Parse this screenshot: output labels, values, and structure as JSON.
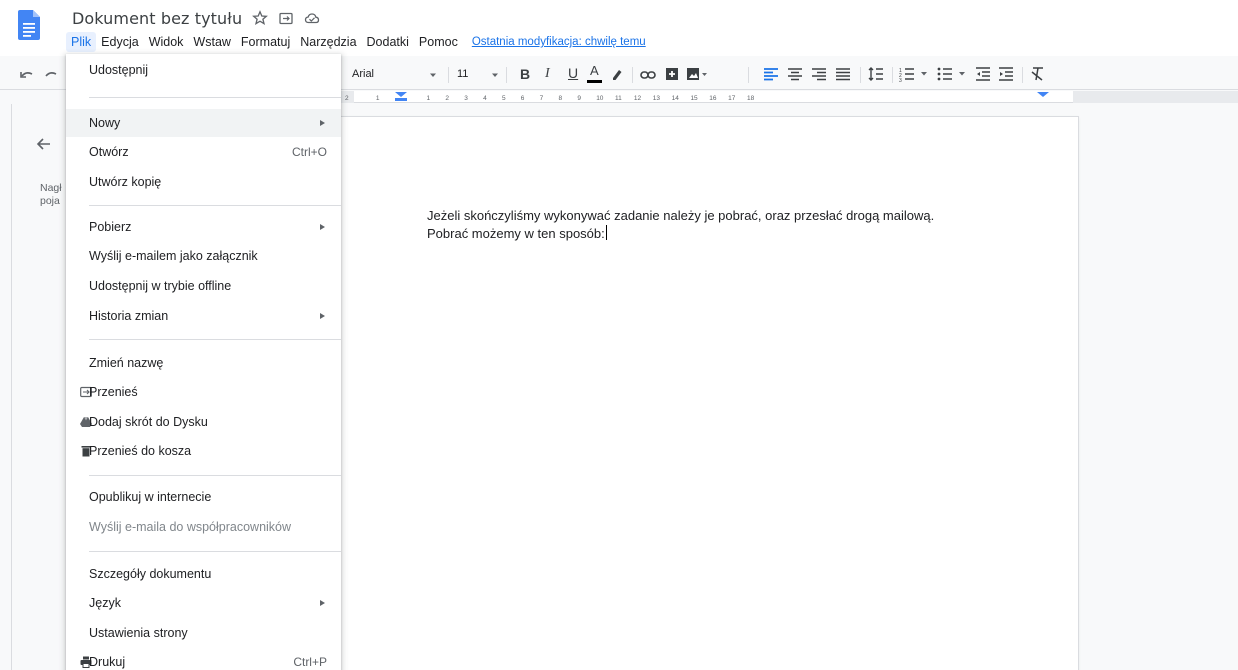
{
  "header": {
    "doc_title": "Dokument bez tytułu",
    "icons": [
      "star-icon",
      "folder-move-icon",
      "cloud-status-icon"
    ],
    "menu": [
      "Plik",
      "Edycja",
      "Widok",
      "Wstaw",
      "Formatuj",
      "Narzędzia",
      "Dodatki",
      "Pomoc"
    ],
    "last_modified": "Ostatnia modyfikacja: chwilę temu"
  },
  "toolbar": {
    "font": "Arial",
    "font_size": "11",
    "buttons": [
      "bold-icon",
      "italic-icon",
      "underline-icon",
      "text-color-icon",
      "highlight-icon",
      "link-icon",
      "comment-icon",
      "image-icon",
      "align-left-icon",
      "align-center-icon",
      "align-right-icon",
      "justify-icon",
      "line-spacing-icon",
      "numbered-list-icon",
      "bulleted-list-icon",
      "decrease-indent-icon",
      "increase-indent-icon",
      "clear-formatting-icon"
    ],
    "bold": "B",
    "italic": "I",
    "underline": "U",
    "text_color": "A"
  },
  "ruler": {
    "marks": [
      "2",
      "1",
      "1",
      "2",
      "3",
      "4",
      "5",
      "6",
      "7",
      "8",
      "9",
      "10",
      "11",
      "12",
      "13",
      "14",
      "15",
      "16",
      "17",
      "18"
    ]
  },
  "outline": {
    "heading_fragment": "Nagł",
    "text_fragment": "poja"
  },
  "document": {
    "line1": "Jeżeli skończyliśmy wykonywać zadanie należy je pobrać, oraz przesłać drogą mailową.",
    "line2": "Pobrać możemy w ten sposób:"
  },
  "file_menu": {
    "items": [
      {
        "label": "Udostępnij"
      },
      {
        "label": "Nowy",
        "submenu": true
      },
      {
        "label": "Otwórz",
        "shortcut": "Ctrl+O"
      },
      {
        "label": "Utwórz kopię"
      },
      {
        "label": "Pobierz",
        "submenu": true
      },
      {
        "label": "Wyślij e-mailem jako załącznik"
      },
      {
        "label": "Udostępnij w trybie offline"
      },
      {
        "label": "Historia zmian",
        "submenu": true
      },
      {
        "label": "Zmień nazwę"
      },
      {
        "label": "Przenieś",
        "icon": "folder-move-icon"
      },
      {
        "label": "Dodaj skrót do Dysku",
        "icon": "drive-shortcut-icon"
      },
      {
        "label": "Przenieś do kosza",
        "icon": "trash-icon"
      },
      {
        "label": "Opublikuj w internecie"
      },
      {
        "label": "Wyślij e-maila do współpracowników",
        "disabled": true
      },
      {
        "label": "Szczegóły dokumentu"
      },
      {
        "label": "Język",
        "submenu": true
      },
      {
        "label": "Ustawienia strony"
      },
      {
        "label": "Drukuj",
        "shortcut": "Ctrl+P",
        "icon": "print-icon"
      }
    ]
  },
  "colors": {
    "accent": "#1a73e8",
    "docs_blue": "#4285f4",
    "menu_highlight": "#e8f0fe"
  }
}
